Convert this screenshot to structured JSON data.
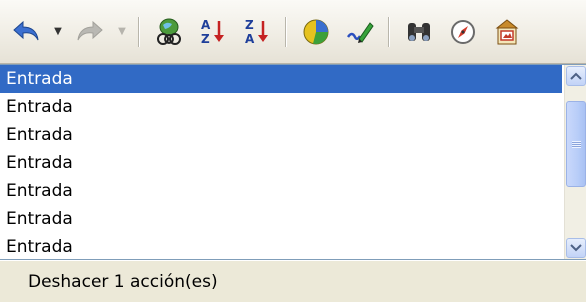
{
  "toolbar": {
    "icons": [
      "undo-icon",
      "redo-icon",
      "data-sources-icon",
      "sort-ascending-icon",
      "sort-descending-icon",
      "chart-icon",
      "draw-functions-icon",
      "find-replace-icon",
      "navigator-icon",
      "gallery-icon"
    ]
  },
  "undo_list": {
    "items": [
      "Entrada",
      "Entrada",
      "Entrada",
      "Entrada",
      "Entrada",
      "Entrada",
      "Entrada"
    ],
    "selected_count": 1
  },
  "status": {
    "text": "Deshacer 1 acción(es)"
  },
  "colors": {
    "selection": "#316ac5",
    "toolbar_bg": "#efece3"
  }
}
